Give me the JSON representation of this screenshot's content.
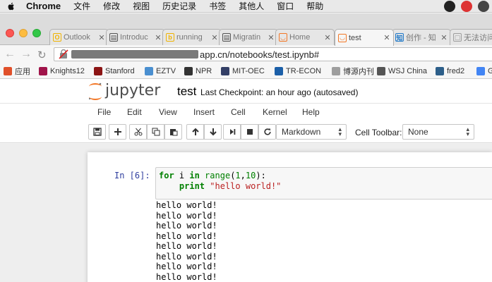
{
  "menubar": {
    "app_name": "Chrome",
    "items": [
      "文件",
      "修改",
      "视图",
      "历史记录",
      "书签",
      "其他人",
      "窗口",
      "帮助"
    ]
  },
  "tabs": [
    {
      "label": "Outlook",
      "icon": "outlook-icon",
      "color": "#f0b300",
      "glyph": "O"
    },
    {
      "label": "Introduc",
      "icon": "doc-icon",
      "color": "#555555",
      "glyph": "▤"
    },
    {
      "label": "running",
      "icon": "bing-icon",
      "color": "#f0b300",
      "glyph": "b"
    },
    {
      "label": "Migratin",
      "icon": "doc-icon",
      "color": "#555555",
      "glyph": "▤"
    },
    {
      "label": "Home",
      "icon": "jupyter-icon",
      "color": "#f37726",
      "glyph": "◡"
    },
    {
      "label": "test",
      "icon": "jupyter-icon",
      "color": "#f37726",
      "glyph": "◡",
      "active": true
    },
    {
      "label": "创作 - 知",
      "icon": "zhihu-icon",
      "color": "#1e78c8",
      "glyph": "知"
    },
    {
      "label": "无法访问",
      "icon": "page-icon",
      "color": "#9e9e9e",
      "glyph": "▢"
    }
  ],
  "address": {
    "url_visible": "app.cn/notebooks/test.ipynb#"
  },
  "bookmarks": [
    {
      "label": "应用",
      "icon": "apps-icon",
      "color": "#e0502a"
    },
    {
      "label": "Knights12",
      "icon": "knight-icon",
      "color": "#a0144a"
    },
    {
      "label": "Stanford",
      "icon": "stanford-icon",
      "color": "#8c1515"
    },
    {
      "label": "EZTV",
      "icon": "eztv-icon",
      "color": "#4a8fd0"
    },
    {
      "label": "NPR",
      "icon": "npr-icon",
      "color": "#333333"
    },
    {
      "label": "MIT-OEC",
      "icon": "globe-icon",
      "color": "#333f66"
    },
    {
      "label": "TR-ECON",
      "icon": "tr-icon",
      "color": "#1b5fa8"
    },
    {
      "label": "博源内刊",
      "icon": "page-icon",
      "color": "#9e9e9e"
    },
    {
      "label": "WSJ China",
      "icon": "wsj-icon",
      "color": "#555555"
    },
    {
      "label": "fred2",
      "icon": "fred-icon",
      "color": "#2d5f8a"
    },
    {
      "label": "G",
      "icon": "google-icon",
      "color": "#4285f4"
    }
  ],
  "notebook": {
    "logo_text": "jupyter",
    "name": "test",
    "checkpoint": "Last Checkpoint: an hour ago (autosaved)"
  },
  "jmenu": [
    "File",
    "Edit",
    "View",
    "Insert",
    "Cell",
    "Kernel",
    "Help"
  ],
  "toolbar": {
    "cell_type": "Markdown",
    "cell_toolbar_label": "Cell Toolbar:",
    "cell_toolbar_value": "None",
    "buttons": [
      "save-icon",
      "plus-icon",
      "cut-icon",
      "copy-icon",
      "paste-icon",
      "arrow-up-icon",
      "arrow-down-icon",
      "run-icon",
      "stop-icon",
      "restart-icon"
    ]
  },
  "cell": {
    "prompt": "In [6]:",
    "code_line1": {
      "kw1": "for",
      "var": " i ",
      "kw2": "in",
      "fn": " range",
      "open": "(",
      "n1": "1",
      "comma": ",",
      "n2": "10",
      "close": "):"
    },
    "code_line2": {
      "kw": "print",
      "str": "\"hello world!\""
    },
    "output": [
      "hello world!",
      "hello world!",
      "hello world!",
      "hello world!",
      "hello world!",
      "hello world!",
      "hello world!",
      "hello world!"
    ]
  }
}
